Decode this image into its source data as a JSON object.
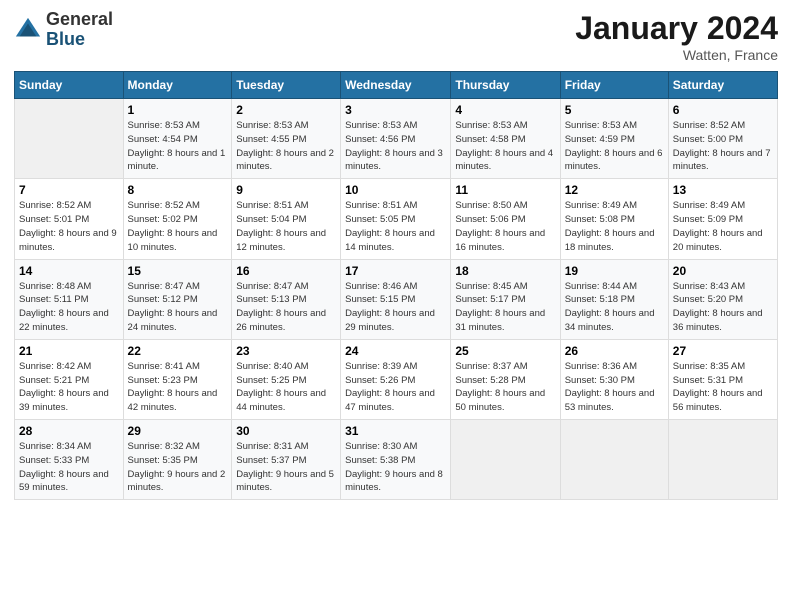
{
  "header": {
    "logo": {
      "general": "General",
      "blue": "Blue"
    },
    "title": "January 2024",
    "location": "Watten, France"
  },
  "weekdays": [
    "Sunday",
    "Monday",
    "Tuesday",
    "Wednesday",
    "Thursday",
    "Friday",
    "Saturday"
  ],
  "weeks": [
    [
      {
        "day": "",
        "sunrise": "",
        "sunset": "",
        "daylight": "",
        "empty": true
      },
      {
        "day": "1",
        "sunrise": "Sunrise: 8:53 AM",
        "sunset": "Sunset: 4:54 PM",
        "daylight": "Daylight: 8 hours and 1 minute."
      },
      {
        "day": "2",
        "sunrise": "Sunrise: 8:53 AM",
        "sunset": "Sunset: 4:55 PM",
        "daylight": "Daylight: 8 hours and 2 minutes."
      },
      {
        "day": "3",
        "sunrise": "Sunrise: 8:53 AM",
        "sunset": "Sunset: 4:56 PM",
        "daylight": "Daylight: 8 hours and 3 minutes."
      },
      {
        "day": "4",
        "sunrise": "Sunrise: 8:53 AM",
        "sunset": "Sunset: 4:58 PM",
        "daylight": "Daylight: 8 hours and 4 minutes."
      },
      {
        "day": "5",
        "sunrise": "Sunrise: 8:53 AM",
        "sunset": "Sunset: 4:59 PM",
        "daylight": "Daylight: 8 hours and 6 minutes."
      },
      {
        "day": "6",
        "sunrise": "Sunrise: 8:52 AM",
        "sunset": "Sunset: 5:00 PM",
        "daylight": "Daylight: 8 hours and 7 minutes."
      }
    ],
    [
      {
        "day": "7",
        "sunrise": "Sunrise: 8:52 AM",
        "sunset": "Sunset: 5:01 PM",
        "daylight": "Daylight: 8 hours and 9 minutes."
      },
      {
        "day": "8",
        "sunrise": "Sunrise: 8:52 AM",
        "sunset": "Sunset: 5:02 PM",
        "daylight": "Daylight: 8 hours and 10 minutes."
      },
      {
        "day": "9",
        "sunrise": "Sunrise: 8:51 AM",
        "sunset": "Sunset: 5:04 PM",
        "daylight": "Daylight: 8 hours and 12 minutes."
      },
      {
        "day": "10",
        "sunrise": "Sunrise: 8:51 AM",
        "sunset": "Sunset: 5:05 PM",
        "daylight": "Daylight: 8 hours and 14 minutes."
      },
      {
        "day": "11",
        "sunrise": "Sunrise: 8:50 AM",
        "sunset": "Sunset: 5:06 PM",
        "daylight": "Daylight: 8 hours and 16 minutes."
      },
      {
        "day": "12",
        "sunrise": "Sunrise: 8:49 AM",
        "sunset": "Sunset: 5:08 PM",
        "daylight": "Daylight: 8 hours and 18 minutes."
      },
      {
        "day": "13",
        "sunrise": "Sunrise: 8:49 AM",
        "sunset": "Sunset: 5:09 PM",
        "daylight": "Daylight: 8 hours and 20 minutes."
      }
    ],
    [
      {
        "day": "14",
        "sunrise": "Sunrise: 8:48 AM",
        "sunset": "Sunset: 5:11 PM",
        "daylight": "Daylight: 8 hours and 22 minutes."
      },
      {
        "day": "15",
        "sunrise": "Sunrise: 8:47 AM",
        "sunset": "Sunset: 5:12 PM",
        "daylight": "Daylight: 8 hours and 24 minutes."
      },
      {
        "day": "16",
        "sunrise": "Sunrise: 8:47 AM",
        "sunset": "Sunset: 5:13 PM",
        "daylight": "Daylight: 8 hours and 26 minutes."
      },
      {
        "day": "17",
        "sunrise": "Sunrise: 8:46 AM",
        "sunset": "Sunset: 5:15 PM",
        "daylight": "Daylight: 8 hours and 29 minutes."
      },
      {
        "day": "18",
        "sunrise": "Sunrise: 8:45 AM",
        "sunset": "Sunset: 5:17 PM",
        "daylight": "Daylight: 8 hours and 31 minutes."
      },
      {
        "day": "19",
        "sunrise": "Sunrise: 8:44 AM",
        "sunset": "Sunset: 5:18 PM",
        "daylight": "Daylight: 8 hours and 34 minutes."
      },
      {
        "day": "20",
        "sunrise": "Sunrise: 8:43 AM",
        "sunset": "Sunset: 5:20 PM",
        "daylight": "Daylight: 8 hours and 36 minutes."
      }
    ],
    [
      {
        "day": "21",
        "sunrise": "Sunrise: 8:42 AM",
        "sunset": "Sunset: 5:21 PM",
        "daylight": "Daylight: 8 hours and 39 minutes."
      },
      {
        "day": "22",
        "sunrise": "Sunrise: 8:41 AM",
        "sunset": "Sunset: 5:23 PM",
        "daylight": "Daylight: 8 hours and 42 minutes."
      },
      {
        "day": "23",
        "sunrise": "Sunrise: 8:40 AM",
        "sunset": "Sunset: 5:25 PM",
        "daylight": "Daylight: 8 hours and 44 minutes."
      },
      {
        "day": "24",
        "sunrise": "Sunrise: 8:39 AM",
        "sunset": "Sunset: 5:26 PM",
        "daylight": "Daylight: 8 hours and 47 minutes."
      },
      {
        "day": "25",
        "sunrise": "Sunrise: 8:37 AM",
        "sunset": "Sunset: 5:28 PM",
        "daylight": "Daylight: 8 hours and 50 minutes."
      },
      {
        "day": "26",
        "sunrise": "Sunrise: 8:36 AM",
        "sunset": "Sunset: 5:30 PM",
        "daylight": "Daylight: 8 hours and 53 minutes."
      },
      {
        "day": "27",
        "sunrise": "Sunrise: 8:35 AM",
        "sunset": "Sunset: 5:31 PM",
        "daylight": "Daylight: 8 hours and 56 minutes."
      }
    ],
    [
      {
        "day": "28",
        "sunrise": "Sunrise: 8:34 AM",
        "sunset": "Sunset: 5:33 PM",
        "daylight": "Daylight: 8 hours and 59 minutes."
      },
      {
        "day": "29",
        "sunrise": "Sunrise: 8:32 AM",
        "sunset": "Sunset: 5:35 PM",
        "daylight": "Daylight: 9 hours and 2 minutes."
      },
      {
        "day": "30",
        "sunrise": "Sunrise: 8:31 AM",
        "sunset": "Sunset: 5:37 PM",
        "daylight": "Daylight: 9 hours and 5 minutes."
      },
      {
        "day": "31",
        "sunrise": "Sunrise: 8:30 AM",
        "sunset": "Sunset: 5:38 PM",
        "daylight": "Daylight: 9 hours and 8 minutes."
      },
      {
        "day": "",
        "sunrise": "",
        "sunset": "",
        "daylight": "",
        "empty": true
      },
      {
        "day": "",
        "sunrise": "",
        "sunset": "",
        "daylight": "",
        "empty": true
      },
      {
        "day": "",
        "sunrise": "",
        "sunset": "",
        "daylight": "",
        "empty": true
      }
    ]
  ]
}
